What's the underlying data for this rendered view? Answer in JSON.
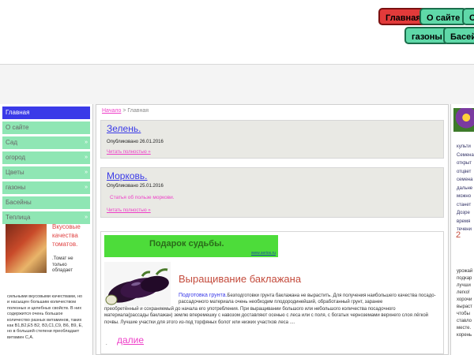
{
  "topnav": {
    "row1": [
      "Главная",
      "О сайте",
      "Са"
    ],
    "row2": [
      "газоны",
      "Басейн"
    ]
  },
  "sidebar": {
    "items": [
      {
        "label": "Главная",
        "arrow": ""
      },
      {
        "label": "О сайте",
        "arrow": ""
      },
      {
        "label": "Сад",
        "arrow": "»"
      },
      {
        "label": "огород",
        "arrow": "»"
      },
      {
        "label": "Цветы",
        "arrow": "»"
      },
      {
        "label": "газоны",
        "arrow": "»"
      },
      {
        "label": "Басейны",
        "arrow": ""
      },
      {
        "label": "Теплица",
        "arrow": "»"
      }
    ],
    "promo": {
      "title": "Вкусовые качества томатов.",
      "subtitle": ".Томат не только обладает",
      "text": "сильными вкусовыми качествами, но и насыщен большим количеством полезных и целебных свойств. В них содержится очень большое количество разных витаминов, таких как B1,B2,E5 B2, B3,C1,C9, B6, B9, E, но в большей степени преобладает витамин С,А."
    }
  },
  "breadcrumb": {
    "home": "Начало",
    "sep": ">",
    "current": "Главная"
  },
  "posts": [
    {
      "title": "Зелень.",
      "date": "Опубликовано 26.01.2016",
      "excerpt": "",
      "more": "Читать полностью »"
    },
    {
      "title": "Морковь.",
      "date": "Опубликовано 25.01.2016",
      "excerpt": "Статья об пользе моркови.",
      "more": "Читать полностью »"
    }
  ],
  "article": {
    "banner": "Подарок судьбы.",
    "banner_url": "www.serios.ru",
    "title": "Выращивание баклажана",
    "link": "Подготовка грунта.",
    "text1": "Безподготовки грунта баклажана не вырастить. Для получения наибольшего качества посадо-рассадочного материала очень необходим плодородинейший, обработанный грунт, заранее",
    "text2": "преобретённый и сохраняемый до начала его употребления. При выращивании большого или небольшого количества посадочного материала(рассады баклажан) землю вперемешку с навозом доставляют осенью с леса или с поля, с богатых черноземами верхнего слоя лёгкой почвы. Лучшие участки для этого из-под торфяных болот или низких участков леса ....",
    "dot": ".",
    "more": "далие"
  },
  "right": {
    "lines": [
      "культи",
      "Семена",
      "открыт",
      "отцвет",
      "семена",
      "дальне",
      "можно",
      "станет",
      "Дозре",
      "время",
      "течени"
    ],
    "number": "2",
    "lines2": [
      "урожай",
      "подкар",
      "лучши",
      "легко!",
      "хорочи",
      "выраст",
      "чтобы",
      "ставло",
      "месте.",
      "корень"
    ]
  }
}
